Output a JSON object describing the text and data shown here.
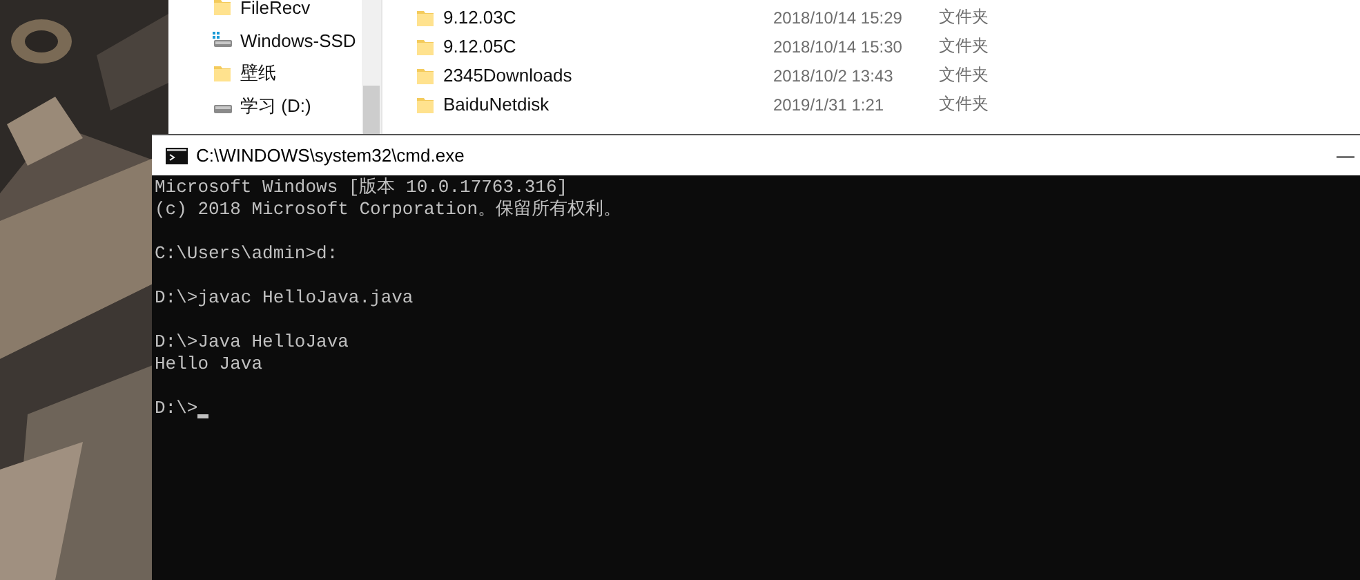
{
  "explorer": {
    "nav_items": [
      {
        "label": "FileRecv",
        "kind": "folder"
      },
      {
        "label": "Windows-SSD",
        "kind": "drive-system"
      },
      {
        "label": "壁纸",
        "kind": "folder"
      },
      {
        "label": "学习 (D:)",
        "kind": "drive"
      }
    ],
    "files": [
      {
        "name": "9.12.03C",
        "date": "2018/10/14 15:29",
        "type": "文件夹"
      },
      {
        "name": "9.12.05C",
        "date": "2018/10/14 15:30",
        "type": "文件夹"
      },
      {
        "name": "2345Downloads",
        "date": "2018/10/2 13:43",
        "type": "文件夹"
      },
      {
        "name": "BaiduNetdisk",
        "date": "2019/1/31 1:21",
        "type": "文件夹"
      }
    ]
  },
  "console_window": {
    "title": "C:\\WINDOWS\\system32\\cmd.exe",
    "minimize": "—",
    "blocks": [
      [
        "Microsoft Windows [版本 10.0.17763.316]",
        "(c) 2018 Microsoft Corporation。保留所有权利。"
      ],
      [
        "C:\\Users\\admin>d:"
      ],
      [
        "D:\\>javac HelloJava.java"
      ],
      [
        "D:\\>Java HelloJava",
        "Hello Java"
      ],
      [
        "D:\\>"
      ]
    ],
    "cursor": true
  }
}
